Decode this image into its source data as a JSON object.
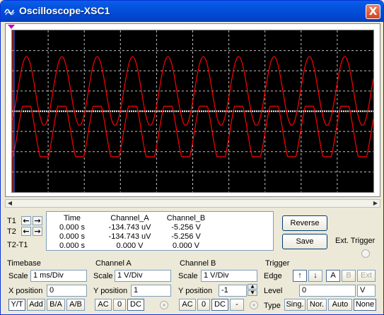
{
  "window": {
    "title": "Oscilloscope-XSC1",
    "close_label": "X"
  },
  "colors": {
    "trace": "#ff0000",
    "grid": "#c0c0c0",
    "screen_bg": "#000000",
    "centerline": "#ffffff"
  },
  "cursors": {
    "t1_label": "T1",
    "t2_label": "T2",
    "t2t1_label": "T2-T1",
    "left_arrow": "←",
    "right_arrow": "→"
  },
  "readout": {
    "headers": [
      "Time",
      "Channel_A",
      "Channel_B"
    ],
    "rows": [
      [
        "0.000 s",
        "-134.743 uV",
        "-5.256 V"
      ],
      [
        "0.000 s",
        "-134.743 uV",
        "-5.256 V"
      ],
      [
        "0.000 s",
        "0.000 V",
        "0.000 V"
      ]
    ]
  },
  "actions": {
    "reverse": "Reverse",
    "save": "Save",
    "ext_trigger": "Ext. Trigger"
  },
  "timebase": {
    "title": "Timebase",
    "scale_label": "Scale",
    "scale_value": "1 ms/Div",
    "xpos_label": "X position",
    "xpos_value": "0",
    "modes": [
      "Y/T",
      "Add",
      "B/A",
      "A/B"
    ],
    "active_mode": "Y/T"
  },
  "channel_a": {
    "title": "Channel A",
    "scale_label": "Scale",
    "scale_value": "1  V/Div",
    "ypos_label": "Y position",
    "ypos_value": "1",
    "coupling": [
      "AC",
      "0",
      "DC"
    ]
  },
  "channel_b": {
    "title": "Channel B",
    "scale_label": "Scale",
    "scale_value": "1  V/Div",
    "ypos_label": "Y position",
    "ypos_value": "-1",
    "coupling": [
      "AC",
      "0",
      "DC",
      "-"
    ]
  },
  "trigger": {
    "title": "Trigger",
    "edge_label": "Edge",
    "edges": [
      "↑",
      "↓"
    ],
    "sources": [
      "A",
      "B",
      "Ext"
    ],
    "level_label": "Level",
    "level_value": "0",
    "level_unit": "V",
    "type_label": "Type",
    "types": [
      "Sing.",
      "Nor.",
      "Auto",
      "None"
    ],
    "active_type": "None"
  }
}
